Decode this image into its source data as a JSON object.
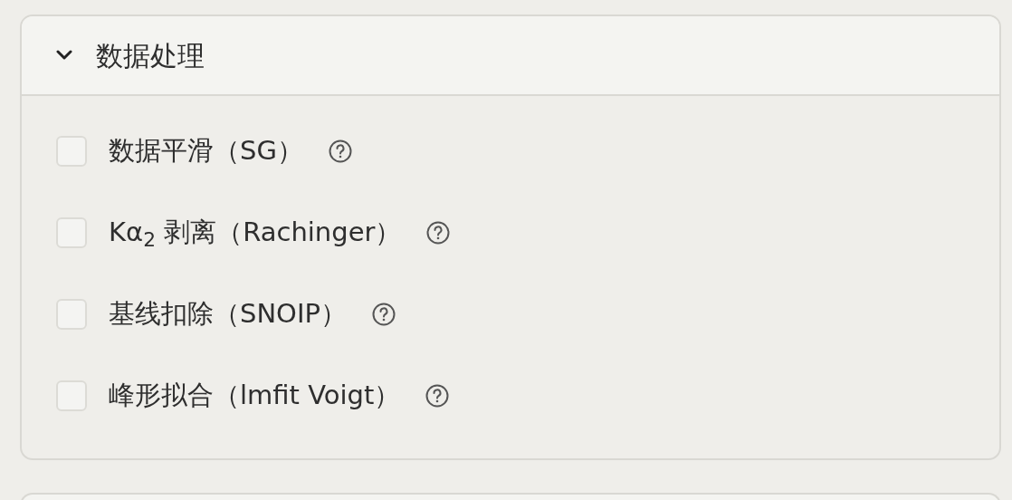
{
  "section": {
    "title": "数据处理",
    "expanded": true,
    "options": [
      {
        "label": "数据平滑（SG）",
        "checked": false
      },
      {
        "label": "Kα$_{2}$ 剥离（Rachinger）",
        "checked": false
      },
      {
        "label": "基线扣除（SNOIP）",
        "checked": false
      },
      {
        "label": "峰形拟合（lmfit Voigt）",
        "checked": false
      }
    ]
  }
}
